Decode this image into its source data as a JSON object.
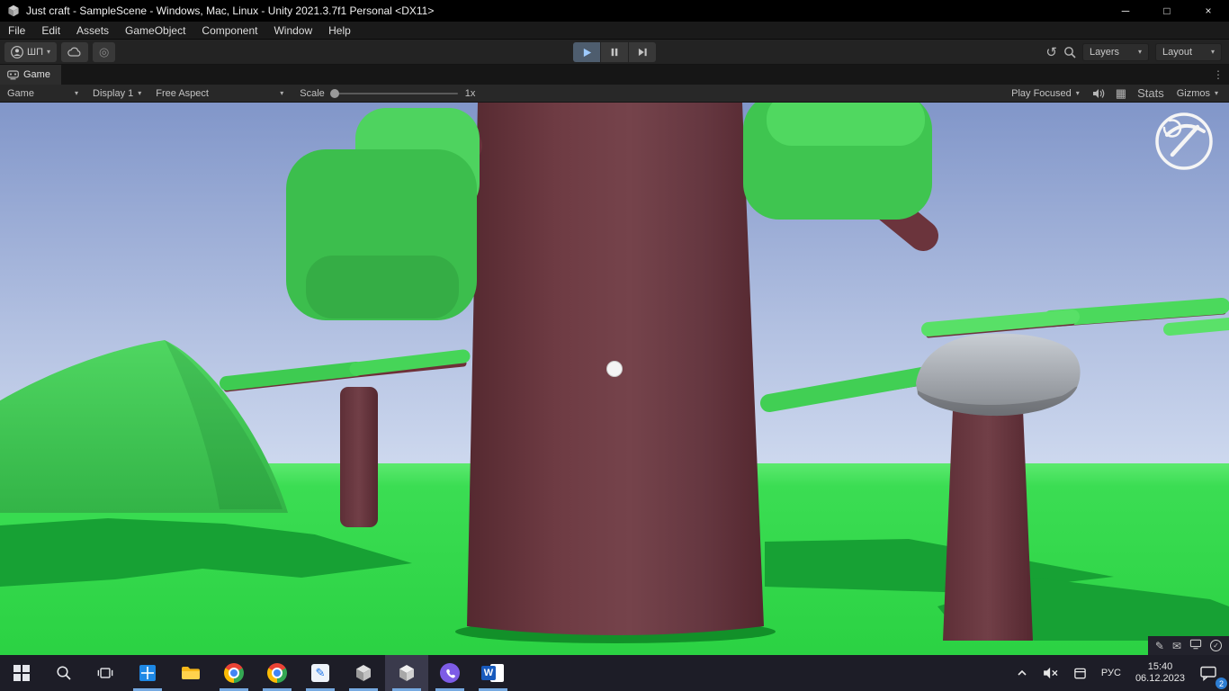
{
  "window": {
    "title": "Just craft - SampleScene - Windows, Mac, Linux - Unity 2021.3.7f1 Personal <DX11>",
    "controls": {
      "minimize": "─",
      "maximize": "□",
      "close": "×"
    }
  },
  "menu": {
    "items": [
      "File",
      "Edit",
      "Assets",
      "GameObject",
      "Component",
      "Window",
      "Help"
    ]
  },
  "toolbar": {
    "account_initials": "ШП",
    "layers": "Layers",
    "layout": "Layout"
  },
  "tabs": {
    "game": "Game"
  },
  "game_toolbar": {
    "view": "Game",
    "display": "Display 1",
    "aspect": "Free Aspect",
    "scale_label": "Scale",
    "scale_value": "1x",
    "play_focused": "Play Focused",
    "stats": "Stats",
    "gizmos": "Gizmos"
  },
  "taskbar": {
    "language": "РУС",
    "time": "15:40",
    "date": "06.12.2023",
    "notifications_count": "2",
    "word_app_letter": "W"
  },
  "scene": {
    "objects": [
      "sky",
      "ground",
      "hill",
      "center-tree-trunk",
      "left-tree",
      "right-tree-with-rock",
      "crosshair-dot",
      "tool-circle-indicator"
    ]
  },
  "colors": {
    "titlebar_bg": "#000000",
    "toolbar_bg": "#232323",
    "taskbar_bg": "#1d1d27",
    "accent": "#76a9e0",
    "sky_top": "#8196c9",
    "sky_bottom": "#cdd8ee",
    "ground": "#2ed847",
    "ground_shadow": "#17a134",
    "foliage": "#3dbe4e",
    "trunk": "#6d3a42",
    "rock": "#a9adb3"
  }
}
